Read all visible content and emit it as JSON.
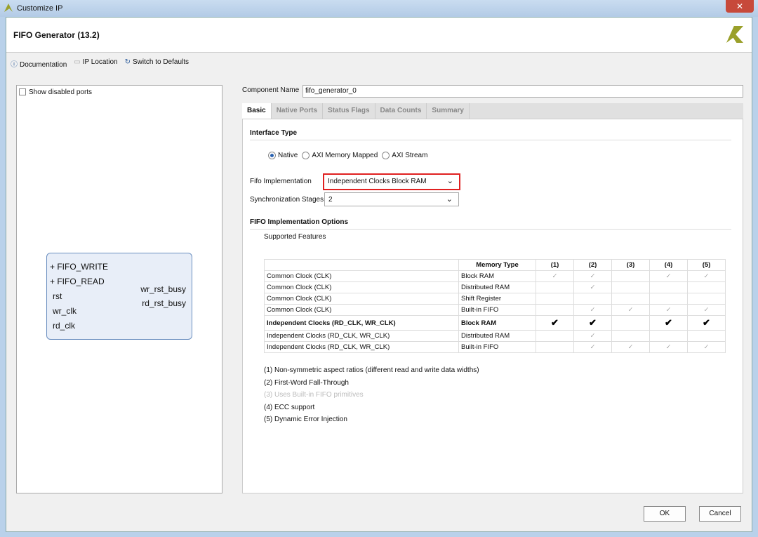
{
  "window": {
    "title": "Customize IP",
    "close": "✕"
  },
  "header": {
    "title": "FIFO Generator (13.2)"
  },
  "toolbar": {
    "documentation": "Documentation",
    "ip_location": "IP Location",
    "switch_defaults": "Switch to Defaults"
  },
  "left": {
    "show_disabled": "Show disabled ports",
    "block": {
      "left_ports": [
        "FIFO_WRITE",
        "FIFO_READ",
        "rst",
        "wr_clk",
        "rd_clk"
      ],
      "right_ports": [
        "wr_rst_busy",
        "rd_rst_busy"
      ]
    }
  },
  "component": {
    "label": "Component Name",
    "value": "fifo_generator_0"
  },
  "tabs": [
    "Basic",
    "Native Ports",
    "Status Flags",
    "Data Counts",
    "Summary"
  ],
  "basic": {
    "interface_type": "Interface Type",
    "radios": [
      "Native",
      "AXI Memory Mapped",
      "AXI Stream"
    ],
    "fifo_impl_label": "Fifo Implementation",
    "fifo_impl_value": "Independent Clocks Block RAM",
    "sync_label": "Synchronization Stages",
    "sync_value": "2",
    "options_title": "FIFO Implementation Options",
    "supported": "Supported Features",
    "table": {
      "headers": [
        "",
        "Memory Type",
        "(1)",
        "(2)",
        "(3)",
        "(4)",
        "(5)"
      ],
      "rows": [
        [
          "Common Clock (CLK)",
          "Block RAM",
          "✓",
          "✓",
          "",
          "✓",
          "✓"
        ],
        [
          "Common Clock (CLK)",
          "Distributed RAM",
          "",
          "✓",
          "",
          "",
          ""
        ],
        [
          "Common Clock (CLK)",
          "Shift Register",
          "",
          "",
          "",
          "",
          ""
        ],
        [
          "Common Clock (CLK)",
          "Built-in FIFO",
          "",
          "✓",
          "✓",
          "✓",
          "✓"
        ],
        [
          "Independent Clocks (RD_CLK, WR_CLK)",
          "Block RAM",
          "✔",
          "✔",
          "",
          "✔",
          "✔"
        ],
        [
          "Independent Clocks (RD_CLK, WR_CLK)",
          "Distributed RAM",
          "",
          "✓",
          "",
          "",
          ""
        ],
        [
          "Independent Clocks (RD_CLK, WR_CLK)",
          "Built-in FIFO",
          "",
          "✓",
          "✓",
          "✓",
          "✓"
        ]
      ]
    },
    "notes": [
      "(1) Non-symmetric aspect ratios (different read and write data widths)",
      "(2) First-Word Fall-Through",
      "(3) Uses Built-in FIFO primitives",
      "(4) ECC support",
      "(5) Dynamic Error Injection"
    ]
  },
  "buttons": {
    "ok": "OK",
    "cancel": "Cancel"
  },
  "colors": {
    "highlight": "#e02020",
    "accent": "#2b62b0"
  }
}
